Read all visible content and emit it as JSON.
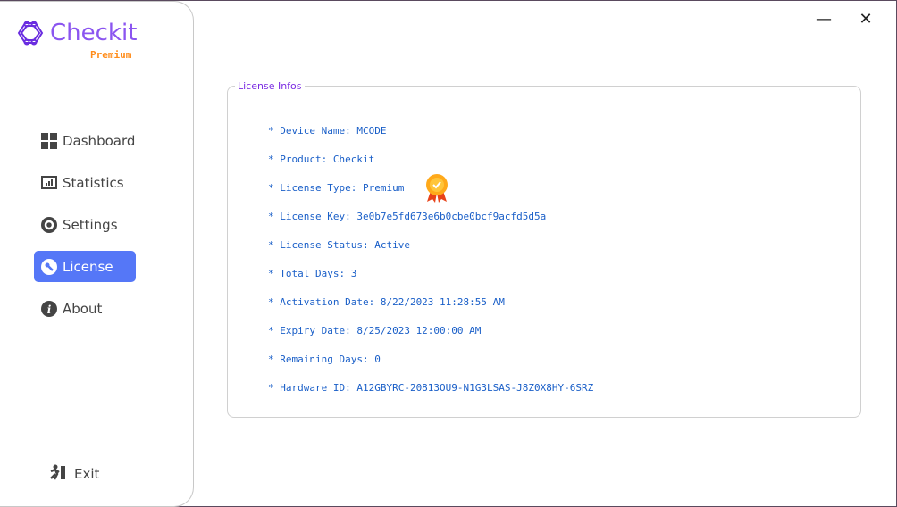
{
  "app": {
    "name": "Checkit",
    "edition": "Premium"
  },
  "nav": [
    {
      "label": "Dashboard",
      "icon": "dashboard-icon"
    },
    {
      "label": "Statistics",
      "icon": "statistics-icon"
    },
    {
      "label": "Settings",
      "icon": "gear-icon"
    },
    {
      "label": "License",
      "icon": "key-icon",
      "active": true
    },
    {
      "label": "About",
      "icon": "info-icon"
    }
  ],
  "exit_label": "Exit",
  "window": {
    "minimize": "—",
    "close": "✕"
  },
  "license": {
    "title": "License Infos",
    "rows": [
      "* Device Name: MCODE",
      "* Product: Checkit",
      "* License Type: Premium",
      "* License Key: 3e0b7e5fd673e6b0cbe0bcf9acfd5d5a",
      "* License Status: Active",
      "* Total Days: 3",
      "* Activation Date: 8/22/2023 11:28:55 AM",
      "* Expiry Date: 8/25/2023 12:00:00 AM",
      "* Remaining Days: 0",
      "* Hardware ID: A12GBYRC-20813OU9-N1G3LSAS-J8Z0X8HY-6SRZ"
    ]
  },
  "colors": {
    "accent": "#5577f7",
    "brand": "#8b55f0",
    "premium": "#ff8c1a",
    "text": "#1a5fc8"
  }
}
